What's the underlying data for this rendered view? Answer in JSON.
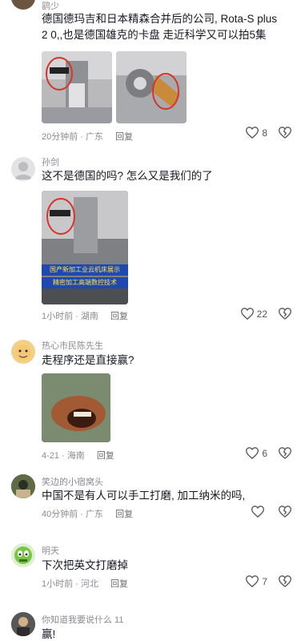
{
  "comments": [
    {
      "username": "鹞少",
      "text": "德国德玛吉和日本精森合并后的公司, Rota-S plus 2 0,,也是德国雄克的卡盘 走近科学又可以拍5集",
      "time": "20分钟前",
      "location": "广东",
      "reply_label": "回复",
      "likes": "8",
      "images": [
        "machine-tool-photo-1",
        "machine-tool-photo-2"
      ]
    },
    {
      "username": "孙剑",
      "text": "这不是德国的吗? 怎么又是我们的了",
      "time": "1小时前",
      "location": "湖南",
      "reply_label": "回复",
      "likes": "22",
      "images": [
        "video-screenshot"
      ],
      "image_caption_1": "国产新加工业云机床展示",
      "image_caption_2": "精密加工高端数控技术"
    },
    {
      "username": "热心市民陈先生",
      "text": "走程序还是直接赢?",
      "time": "4-21",
      "location": "海南",
      "reply_label": "回复",
      "likes": "6",
      "images": [
        "meme-image"
      ]
    },
    {
      "username": "笑边的小宿窝头",
      "text": "中国不是有人可以手工打磨, 加工纳米的吗,",
      "time": "40分钟前",
      "location": "广东",
      "reply_label": "回复",
      "likes": "",
      "images": []
    },
    {
      "username": "明天",
      "text": "下次把英文打磨掉",
      "time": "1小时前",
      "location": "河北",
      "reply_label": "回复",
      "likes": "7",
      "images": []
    },
    {
      "username": "你知道我要说什么 11",
      "text": "赢!",
      "time": "",
      "location": "",
      "reply_label": "",
      "likes": "",
      "images": []
    }
  ],
  "colors": {
    "text": "#161823",
    "meta": "#8a8b91"
  }
}
